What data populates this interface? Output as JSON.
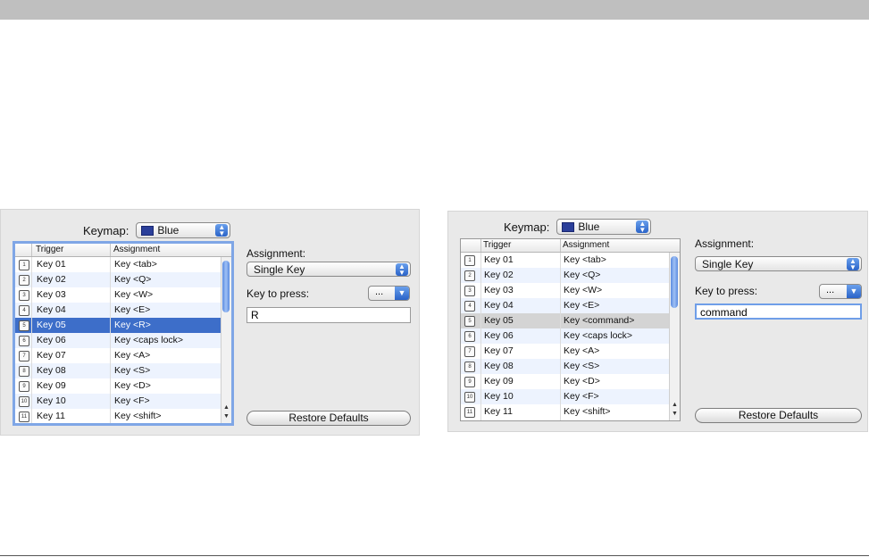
{
  "left": {
    "keymap_label": "Keymap:",
    "keymap_value": "Blue",
    "col_trigger": "Trigger",
    "col_assignment": "Assignment",
    "rows": [
      {
        "icon": "1",
        "trigger": "Key 01",
        "assignment": "Key <tab>"
      },
      {
        "icon": "2",
        "trigger": "Key 02",
        "assignment": "Key <Q>"
      },
      {
        "icon": "3",
        "trigger": "Key 03",
        "assignment": "Key <W>"
      },
      {
        "icon": "4",
        "trigger": "Key 04",
        "assignment": "Key <E>"
      },
      {
        "icon": "5",
        "trigger": "Key 05",
        "assignment": "Key <R>"
      },
      {
        "icon": "6",
        "trigger": "Key 06",
        "assignment": "Key <caps lock>"
      },
      {
        "icon": "7",
        "trigger": "Key 07",
        "assignment": "Key <A>"
      },
      {
        "icon": "8",
        "trigger": "Key 08",
        "assignment": "Key <S>"
      },
      {
        "icon": "9",
        "trigger": "Key 09",
        "assignment": "Key <D>"
      },
      {
        "icon": "10",
        "trigger": "Key 10",
        "assignment": "Key <F>"
      },
      {
        "icon": "11",
        "trigger": "Key 11",
        "assignment": "Key <shift>"
      }
    ],
    "selected_index": 4,
    "assignment_label": "Assignment:",
    "assignment_value": "Single Key",
    "key_to_press_label": "Key to press:",
    "dots_label": "...",
    "key_value": "R",
    "restore_label": "Restore Defaults"
  },
  "right": {
    "keymap_label": "Keymap:",
    "keymap_value": "Blue",
    "col_trigger": "Trigger",
    "col_assignment": "Assignment",
    "rows": [
      {
        "icon": "1",
        "trigger": "Key 01",
        "assignment": "Key <tab>"
      },
      {
        "icon": "2",
        "trigger": "Key 02",
        "assignment": "Key <Q>"
      },
      {
        "icon": "3",
        "trigger": "Key 03",
        "assignment": "Key <W>"
      },
      {
        "icon": "4",
        "trigger": "Key 04",
        "assignment": "Key <E>"
      },
      {
        "icon": "5",
        "trigger": "Key 05",
        "assignment": "Key <command>"
      },
      {
        "icon": "6",
        "trigger": "Key 06",
        "assignment": "Key <caps lock>"
      },
      {
        "icon": "7",
        "trigger": "Key 07",
        "assignment": "Key <A>"
      },
      {
        "icon": "8",
        "trigger": "Key 08",
        "assignment": "Key <S>"
      },
      {
        "icon": "9",
        "trigger": "Key 09",
        "assignment": "Key <D>"
      },
      {
        "icon": "10",
        "trigger": "Key 10",
        "assignment": "Key <F>"
      },
      {
        "icon": "11",
        "trigger": "Key 11",
        "assignment": "Key <shift>"
      }
    ],
    "selected_index": 4,
    "assignment_label": "Assignment:",
    "assignment_value": "Single Key",
    "key_to_press_label": "Key to press:",
    "dots_label": "...",
    "key_value": "command",
    "restore_label": "Restore Defaults"
  },
  "colors": {
    "selection_blue": "#3d6ec9",
    "selection_gray": "#d4d4d4",
    "swatch_blue": "#2b3f9a"
  }
}
